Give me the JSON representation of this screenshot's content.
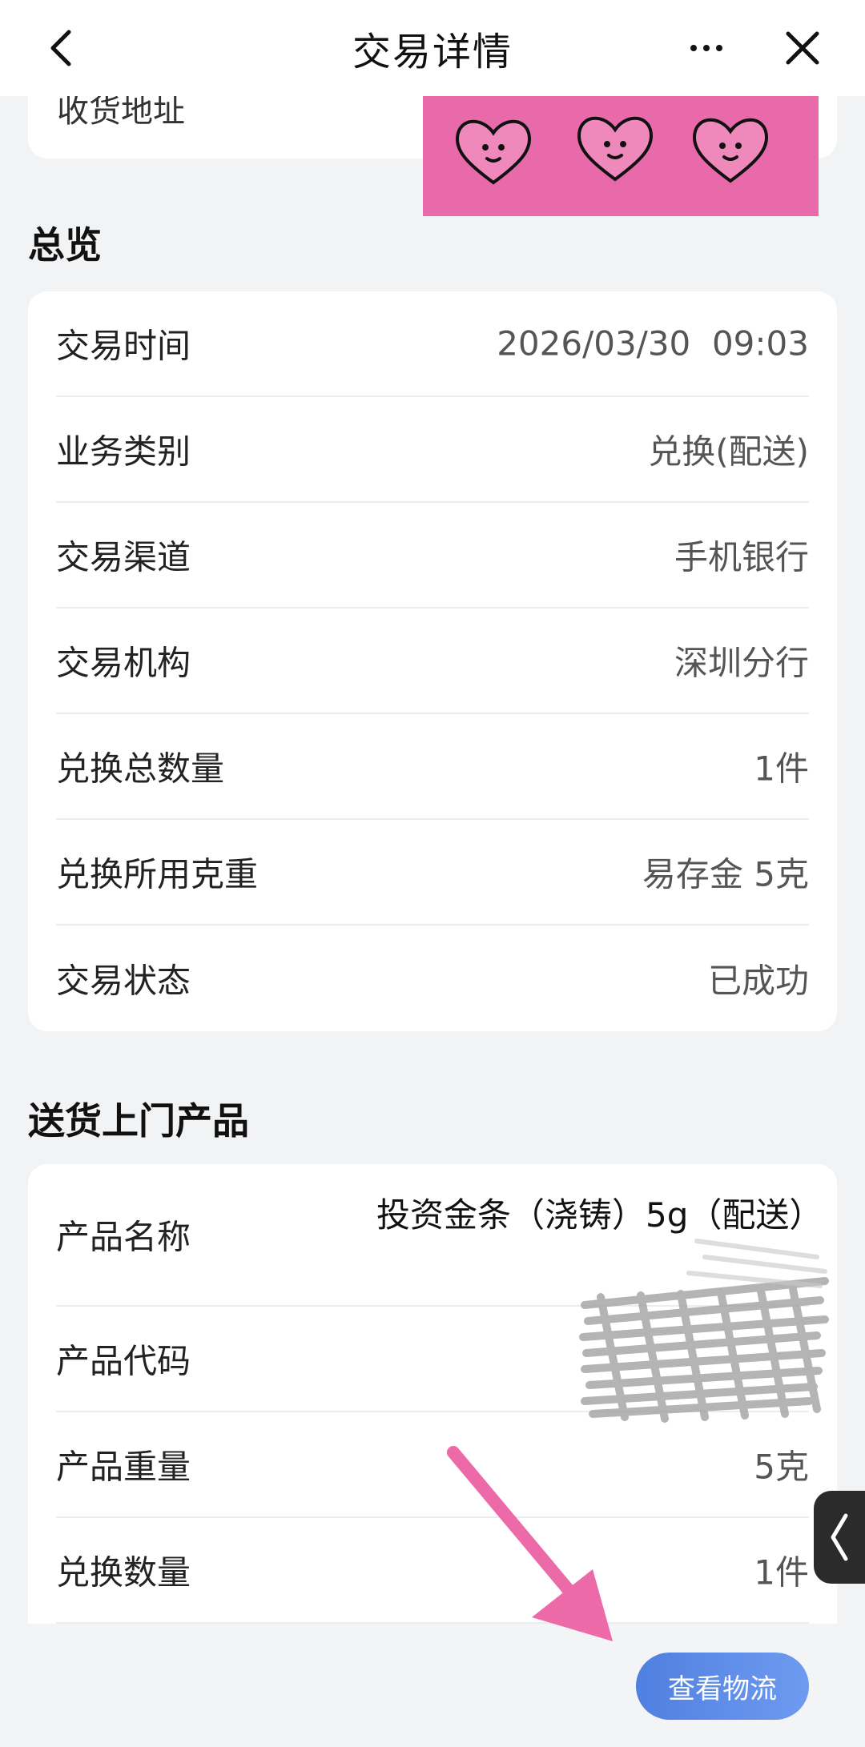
{
  "header": {
    "title": "交易详情"
  },
  "address": {
    "label": "收货地址"
  },
  "overview": {
    "title": "总览",
    "rows": [
      {
        "label": "交易时间",
        "value": "2026/03/30  09:03"
      },
      {
        "label": "业务类别",
        "value": "兑换(配送)"
      },
      {
        "label": "交易渠道",
        "value": "手机银行"
      },
      {
        "label": "交易机构",
        "value": "深圳分行"
      },
      {
        "label": "兑换总数量",
        "value": "1件"
      },
      {
        "label": "兑换所用克重",
        "value": "易存金 5克"
      },
      {
        "label": "交易状态",
        "value": "已成功"
      }
    ]
  },
  "products": {
    "title": "送货上门产品",
    "rows": [
      {
        "label": "产品名称",
        "value": "投资金条（浇铸）5g（配送）"
      },
      {
        "label": "产品代码",
        "value": ""
      },
      {
        "label": "产品重量",
        "value": "5克"
      },
      {
        "label": "兑换数量",
        "value": "1件"
      }
    ]
  },
  "actions": {
    "logistics_label": "查看物流"
  },
  "colors": {
    "accent": "#5a88e8",
    "sticker": "#e96aaa",
    "arrow": "#ec6aa8"
  }
}
